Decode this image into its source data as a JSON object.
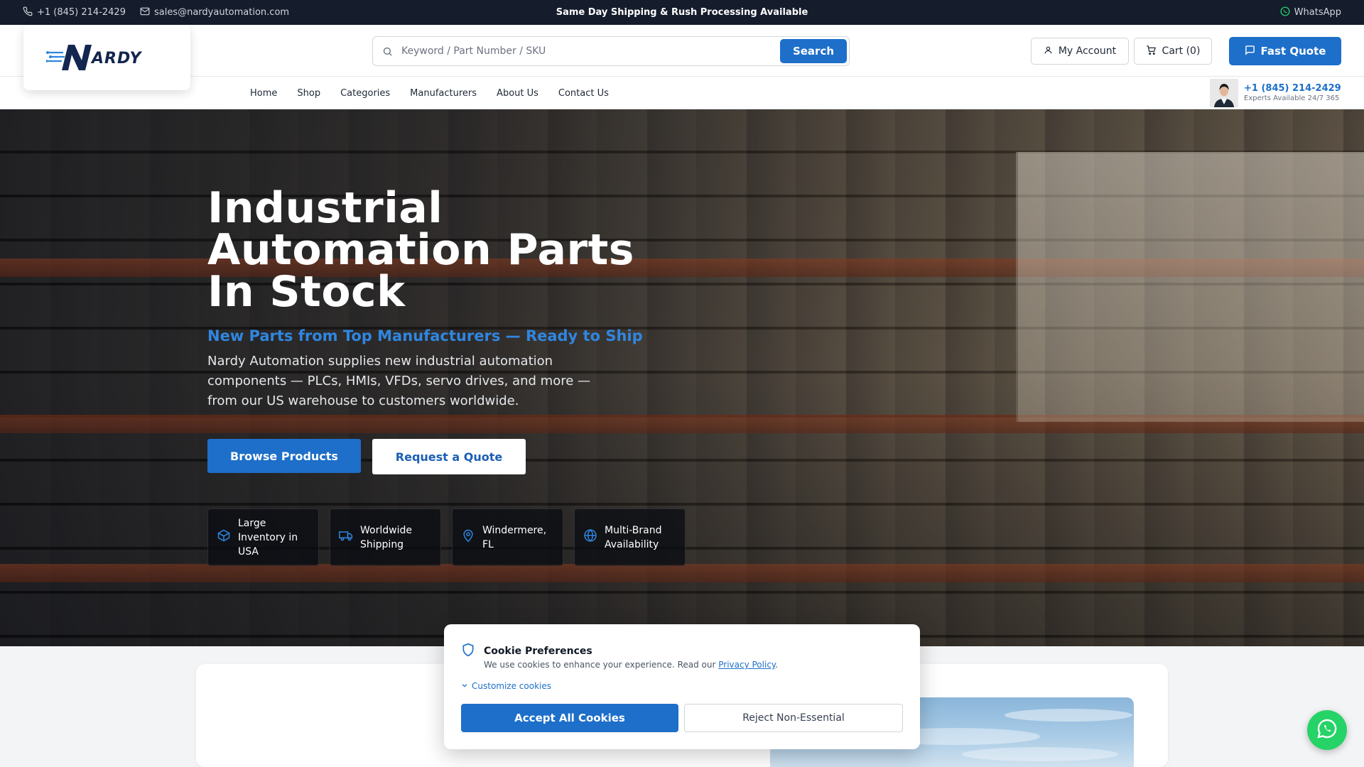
{
  "topbar": {
    "phone": "+1 (845) 214-2429",
    "email": "sales@nardyautomation.com",
    "announcement": "Same Day Shipping & Rush Processing Available",
    "whatsapp": "WhatsApp"
  },
  "header": {
    "logo_text": "NARDY",
    "search_placeholder": "Keyword / Part Number / SKU",
    "search_button": "Search",
    "account": "My Account",
    "cart": "Cart (0)",
    "fast_quote": "Fast Quote"
  },
  "nav": {
    "items": [
      "Home",
      "Shop",
      "Categories",
      "Manufacturers",
      "About Us",
      "Contact Us"
    ],
    "expert_phone": "+1 (845) 214-2429",
    "expert_sub": "Experts Available 24/7 365"
  },
  "hero": {
    "title_lines": [
      "Industrial",
      "Automation Parts",
      "In Stock"
    ],
    "subtitle": "New Parts from Top Manufacturers — Ready to Ship",
    "description": "Nardy Automation supplies new industrial automation components — PLCs, HMIs, VFDs, servo drives, and more — from our US warehouse to customers worldwide.",
    "browse_button": "Browse Products",
    "quote_button": "Request a Quote",
    "features": [
      {
        "label": "Large Inventory in USA",
        "icon": "box-icon"
      },
      {
        "label": "Worldwide Shipping",
        "icon": "truck-icon"
      },
      {
        "label": "Windermere, FL",
        "icon": "map-pin-icon"
      },
      {
        "label": "Multi-Brand Availability",
        "icon": "globe-icon"
      }
    ]
  },
  "cookie": {
    "title": "Cookie Preferences",
    "text": "We use cookies to enhance your experience. Read our ",
    "policy_link": "Privacy Policy",
    "text_end": ".",
    "customize": "Customize cookies",
    "accept": "Accept All Cookies",
    "reject": "Reject Non-Essential"
  },
  "colors": {
    "accent": "#1d6fc9",
    "topbar": "#151c2c",
    "whatsapp": "#25d366"
  }
}
